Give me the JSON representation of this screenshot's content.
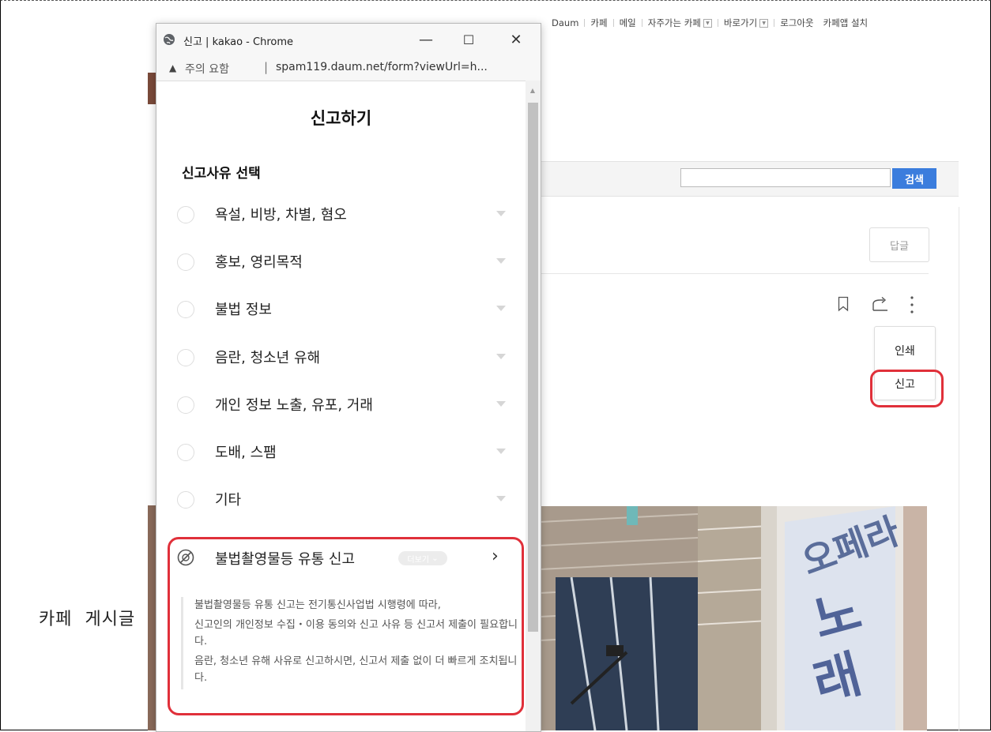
{
  "topnav": {
    "items": [
      "Daum",
      "카페",
      "메일",
      "자주가는 카페",
      "바로가기",
      "로그아웃",
      "카페앱 설치"
    ]
  },
  "search": {
    "value": "",
    "button_label": "검색"
  },
  "article": {
    "reply_button": "답글",
    "menu": {
      "print": "인쇄",
      "report": "신고"
    }
  },
  "side_caption": "카페  게시글",
  "popup": {
    "window_title": "신고 | kakao - Chrome",
    "controls": {
      "minimize": "—",
      "maximize": "☐",
      "close": "✕"
    },
    "security_warning": "주의 요함",
    "url": "spam119.daum.net/form?viewUrl=h...",
    "dialog_title": "신고하기",
    "section_title": "신고사유 선택",
    "reasons": [
      "욕설, 비방, 차별, 혐오",
      "홍보, 영리목적",
      "불법 정보",
      "음란, 청소년 유해",
      "개인 정보 노출, 유포, 거래",
      "도배, 스팸",
      "기타"
    ],
    "illegal_report": {
      "label": "불법촬영물등 유통 신고",
      "more_label": "더보기",
      "notice_1": "불법촬영물등 유통 신고는 전기통신사업법 시행령에 따라,",
      "notice_2": "신고인의 개인정보 수집・이용 동의와 신고 사유 등 신고서 제출이 필요합니다.",
      "notice_3": "음란, 청소년 유해 사유로 신고하시면, 신고서 제출 없이 더 빠르게 조치됩니다."
    }
  },
  "colors": {
    "highlight": "#e0303a",
    "search_button": "#3b7ddd"
  }
}
